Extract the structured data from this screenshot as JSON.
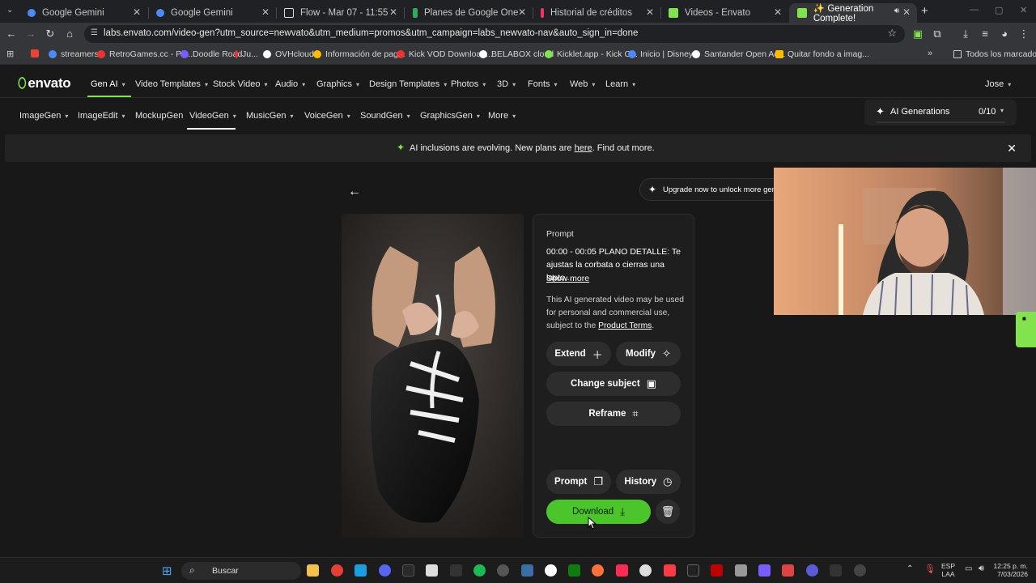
{
  "browser": {
    "tabs": [
      {
        "title": "Google Gemini",
        "color": "#4c8bf5"
      },
      {
        "title": "Google Gemini",
        "color": "#4c8bf5"
      },
      {
        "title": "Flow - Mar 07 - 11:55",
        "color": "#ffffff"
      },
      {
        "title": "Planes de Google One",
        "color": "#34a853"
      },
      {
        "title": "Historial de créditos",
        "color": "#e36"
      },
      {
        "title": "Videos - Envato",
        "color": "#82e34f"
      },
      {
        "title": "✨ Generation Complete!",
        "color": "#82e34f"
      }
    ],
    "url": "labs.envato.com/video-gen?utm_source=newvato&utm_medium=promos&utm_campaign=labs_newvato-nav&auto_sign_in=done",
    "bookmarks": [
      {
        "label": "",
        "color": "#ea4335"
      },
      {
        "label": "streamers",
        "color": "#4c8bf5"
      },
      {
        "label": "RetroGames.cc - Pla...",
        "color": "#e33"
      },
      {
        "label": "Doodle Road",
        "color": "#7b5cff"
      },
      {
        "label": "Ju...",
        "color": "#e33"
      },
      {
        "label": "OVHcloud",
        "color": "#fff"
      },
      {
        "label": "Información de pag...",
        "color": "#fbbc05"
      },
      {
        "label": "Kick VOD Download...",
        "color": "#e33"
      },
      {
        "label": "BELABOX cloud",
        "color": "#fff"
      },
      {
        "label": "Kicklet.app - Kick C...",
        "color": "#82e34f"
      },
      {
        "label": "Inicio | Disney+",
        "color": "#4c8bf5"
      },
      {
        "label": "Santander Open Ac...",
        "color": "#fff"
      },
      {
        "label": "Quitar fondo a imag...",
        "color": "#fbbc05"
      }
    ],
    "all_bookmarks": "Todos los marcadores"
  },
  "envato": {
    "logo": "envato",
    "nav": [
      "Gen AI",
      "Video Templates",
      "Stock Video",
      "Audio",
      "Graphics",
      "Design Templates",
      "Photos",
      "3D",
      "Fonts",
      "Web",
      "Learn"
    ],
    "user": "Jose",
    "subnav": [
      "ImageGen",
      "ImageEdit",
      "MockupGen",
      "VideoGen",
      "MusicGen",
      "VoiceGen",
      "SoundGen",
      "GraphicsGen",
      "More"
    ],
    "ai_generations": {
      "label": "AI Generations",
      "count": "0/10"
    },
    "banner": {
      "before": "AI inclusions are evolving. New plans are ",
      "link": "here",
      "after": ". Find out more."
    },
    "upgrade": "Upgrade now to unlock more genera",
    "panel": {
      "title": "Prompt",
      "prompt": "00:00 - 00:05 PLANO DETALLE: Te ajustas la corbata o cierras una lapto...",
      "show_more": "Show more",
      "desc_before": "This AI generated video may be used for personal and commercial use, subject to the ",
      "desc_link": "Product Terms",
      "desc_after": ".",
      "extend": "Extend",
      "modify": "Modify",
      "change_subject": "Change subject",
      "reframe": "Reframe",
      "prompt_btn": "Prompt",
      "history": "History",
      "download": "Download"
    }
  },
  "taskbar": {
    "search": "Buscar",
    "lang1": "ESP",
    "lang2": "LAA",
    "time": "12:25 p. m.",
    "date": "7/03/2026"
  }
}
